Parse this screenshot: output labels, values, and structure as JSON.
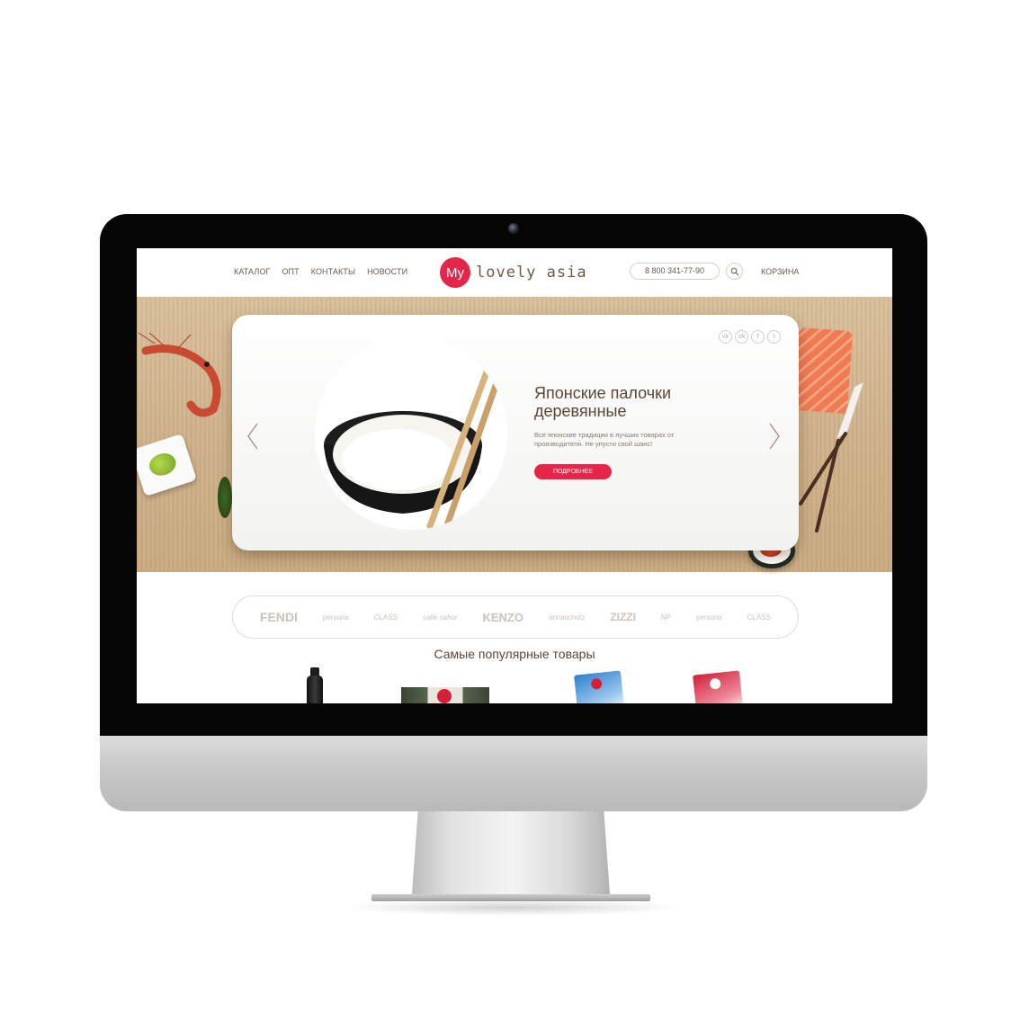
{
  "nav": {
    "links": [
      "КАТАЛОГ",
      "ОПТ",
      "КОНТАКТЫ",
      "НОВОСТИ"
    ],
    "logo_mark": "My",
    "logo_text": "lovely asia",
    "phone": "8 800 341-77-90",
    "cart": "КОРЗИНА"
  },
  "hero": {
    "title": "Японские палочки деревянные",
    "description": "Все японские традиции в лучших товарах от производителя. Не упусти свой шанс!",
    "button": "ПОДРОБНЕЕ",
    "social_icons": [
      "vk-icon",
      "odnoklassniki-icon",
      "facebook-icon",
      "twitter-icon"
    ]
  },
  "brands": [
    "FENDI",
    "persona",
    "CLASS",
    "salle sahor",
    "KENZO",
    "annascholz",
    "ZIZZI",
    "NP",
    "persona",
    "CLASS"
  ],
  "popular": {
    "title": "Самые популярные товары"
  },
  "colors": {
    "accent": "#e5254a",
    "text_brown": "#5b4636",
    "bezel": "#050505"
  }
}
